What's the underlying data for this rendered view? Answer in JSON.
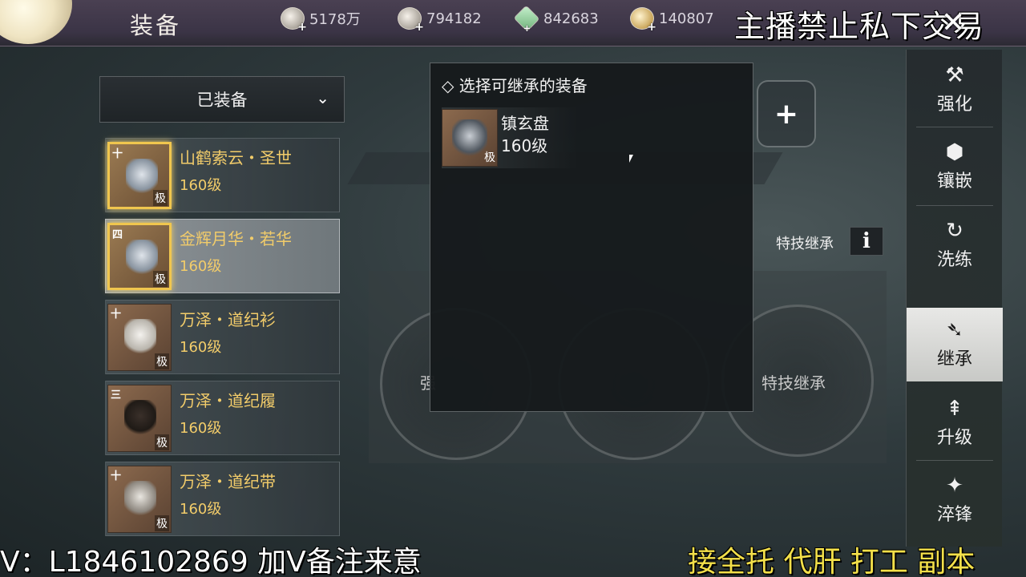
{
  "header": {
    "title": "装备",
    "currencies": [
      {
        "icon": "coin-icon",
        "value": "5178万"
      },
      {
        "icon": "silver-ingot-icon",
        "value": "794182"
      },
      {
        "icon": "jade-icon",
        "value": "842683"
      },
      {
        "icon": "gold-ingot-icon",
        "value": "140807"
      }
    ],
    "notice": "主播禁止私下交易",
    "close_symbol": "✕"
  },
  "filter": {
    "label": "已装备",
    "chevron": "⌄"
  },
  "equipment_list": [
    {
      "tier": "十",
      "name": "山鹤索云・圣世",
      "level": "160级",
      "grade": "极"
    },
    {
      "tier": "四",
      "name": "金辉月华・若华",
      "level": "160级",
      "grade": "极"
    },
    {
      "tier": "十",
      "name": "万泽・道纪衫",
      "level": "160级",
      "grade": "极"
    },
    {
      "tier": "三",
      "name": "万泽・道纪履",
      "level": "160级",
      "grade": "极"
    },
    {
      "tier": "十",
      "name": "万泽・道纪带",
      "level": "160级",
      "grade": "极"
    }
  ],
  "popup": {
    "title": "◇ 选择可继承的装备",
    "entry": {
      "name": "镇玄盘",
      "level": "160级",
      "grade": "极"
    }
  },
  "background": {
    "plus": "+",
    "special_inherit_label": "特技继承",
    "info_symbol": "i",
    "circle_left_label": "强",
    "circle_right_label": "特技继承"
  },
  "sidebar": [
    {
      "icon": "hammer-icon",
      "glyph": "⚒",
      "label": "强化"
    },
    {
      "icon": "socket-icon",
      "glyph": "⬢",
      "label": "镶嵌"
    },
    {
      "icon": "refine-icon",
      "glyph": "↻",
      "label": "洗练"
    },
    {
      "icon": "inherit-icon",
      "glyph": "➴",
      "label": "继承"
    },
    {
      "icon": "upgrade-icon",
      "glyph": "⇞",
      "label": "升级"
    },
    {
      "icon": "temper-icon",
      "glyph": "✦",
      "label": "淬锋"
    }
  ],
  "overlay": {
    "left_text": "V：L1846102869 加V备注来意",
    "right_text": "接全托 代肝 打工 副本"
  }
}
